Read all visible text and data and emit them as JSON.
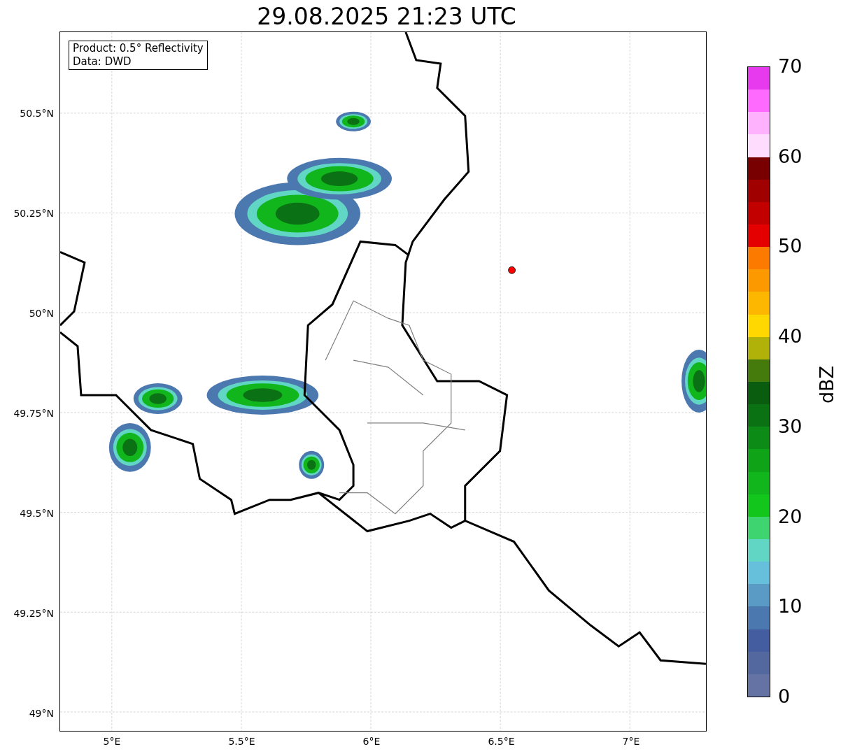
{
  "title": "29.08.2025 21:23 UTC",
  "info_box": [
    "Product: 0.5° Reflectivity",
    "Data: DWD"
  ],
  "map": {
    "lat_ticks": [
      "50.5°N",
      "50.25°N",
      "50°N",
      "49.75°N",
      "49.5°N",
      "49.25°N",
      "49°N"
    ],
    "lon_ticks": [
      "5°E",
      "5.5°E",
      "6°E",
      "6.5°E",
      "7°E"
    ]
  },
  "colorbar": {
    "label": "dBZ",
    "ticks": [
      "70",
      "60",
      "50",
      "40",
      "30",
      "20",
      "10",
      "0"
    ],
    "bins": [
      {
        "color": "#e739ee"
      },
      {
        "color": "#fd6afd"
      },
      {
        "color": "#feb2fe"
      },
      {
        "color": "#fedcfe"
      },
      {
        "color": "#780000"
      },
      {
        "color": "#a00000"
      },
      {
        "color": "#c20000"
      },
      {
        "color": "#e40000"
      },
      {
        "color": "#fd7a00"
      },
      {
        "color": "#fd9900"
      },
      {
        "color": "#fdb700"
      },
      {
        "color": "#fed800"
      },
      {
        "color": "#b0b20a"
      },
      {
        "color": "#457a0c"
      },
      {
        "color": "#0a5c0f"
      },
      {
        "color": "#0b7214"
      },
      {
        "color": "#0c8c16"
      },
      {
        "color": "#0fa317"
      },
      {
        "color": "#10b61b"
      },
      {
        "color": "#12c61c"
      },
      {
        "color": "#3ed571"
      },
      {
        "color": "#62d6c4"
      },
      {
        "color": "#66c0dc"
      },
      {
        "color": "#5a9bc6"
      },
      {
        "color": "#4c78b0"
      },
      {
        "color": "#435da0"
      },
      {
        "color": "#53689f"
      },
      {
        "color": "#6473a3"
      }
    ]
  }
}
